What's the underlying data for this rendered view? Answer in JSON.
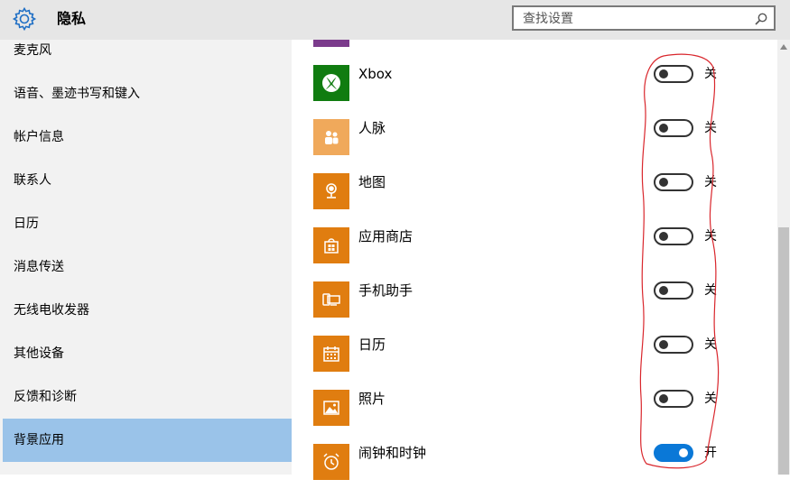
{
  "window": {
    "title": "隐私",
    "icon": "gear-icon"
  },
  "search": {
    "placeholder": "查找设置",
    "icon": "search-icon"
  },
  "sidebar": {
    "items": [
      {
        "label": "麦克风",
        "selected": false
      },
      {
        "label": "语音、墨迹书写和键入",
        "selected": false
      },
      {
        "label": "帐户信息",
        "selected": false
      },
      {
        "label": "联系人",
        "selected": false
      },
      {
        "label": "日历",
        "selected": false
      },
      {
        "label": "消息传送",
        "selected": false
      },
      {
        "label": "无线电收发器",
        "selected": false
      },
      {
        "label": "其他设备",
        "selected": false
      },
      {
        "label": "反馈和诊断",
        "selected": false
      },
      {
        "label": "背景应用",
        "selected": true
      }
    ]
  },
  "apps": [
    {
      "name": "Xbox",
      "icon": "xbox-icon",
      "tile_color": "#107c10",
      "state": "关",
      "on": false
    },
    {
      "name": "人脉",
      "icon": "people-icon",
      "tile_color": "#f0a95b",
      "state": "关",
      "on": false
    },
    {
      "name": "地图",
      "icon": "maps-icon",
      "tile_color": "#e07d10",
      "state": "关",
      "on": false
    },
    {
      "name": "应用商店",
      "icon": "store-icon",
      "tile_color": "#e07d10",
      "state": "关",
      "on": false
    },
    {
      "name": "手机助手",
      "icon": "phone-companion-icon",
      "tile_color": "#e07d10",
      "state": "关",
      "on": false
    },
    {
      "name": "日历",
      "icon": "calendar-icon",
      "tile_color": "#e07d10",
      "state": "关",
      "on": false
    },
    {
      "name": "照片",
      "icon": "photos-icon",
      "tile_color": "#e07d10",
      "state": "关",
      "on": false
    },
    {
      "name": "闹钟和时钟",
      "icon": "alarm-clock-icon",
      "tile_color": "#e07d10",
      "state": "开",
      "on": true
    }
  ],
  "colors": {
    "accent": "#0a78d7",
    "selected_bg": "#9ac3e9",
    "annotation": "#d9262c"
  }
}
